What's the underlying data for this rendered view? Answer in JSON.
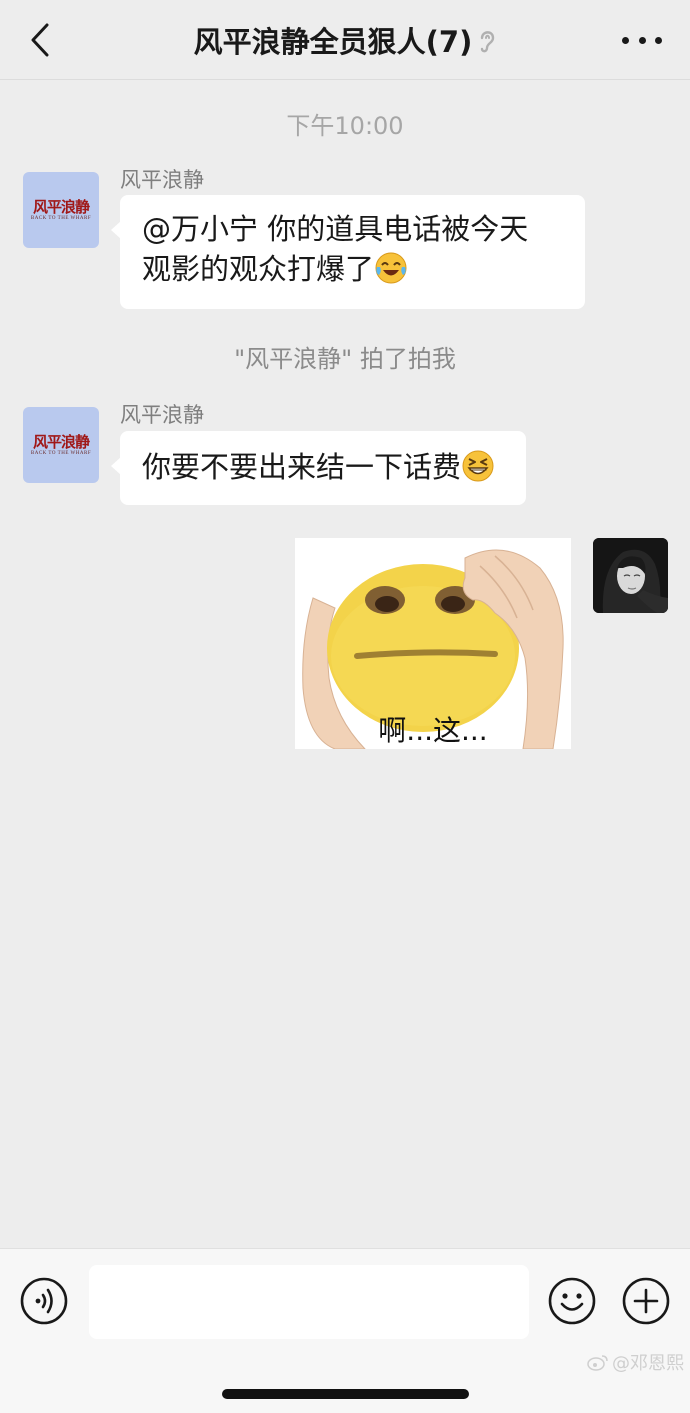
{
  "header": {
    "title": "风平浪静全员狠人(7)"
  },
  "chat": {
    "timestamp": "下午10:00",
    "messages": [
      {
        "sender": "风平浪静",
        "text": "@万小宁 你的道具电话被今天观影的观众打爆了",
        "line1": "@万小宁 你的道具电话被今天",
        "line2": "观影的观众打爆了",
        "emoji": "laughing-crying-emoji"
      },
      {
        "sender": "风平浪静",
        "text": "你要不要出来结一下话费",
        "emoji": "grinning-squint-emoji"
      }
    ],
    "system_notice": "\"风平浪静\" 拍了拍我",
    "sticker": {
      "caption": "啊...这..."
    },
    "group_avatar": {
      "logo_text": "风平浪静",
      "logo_sub": "BACK TO THE WHARF"
    }
  },
  "watermark": "@邓恩熙",
  "colors": {
    "background": "#ededed",
    "bubble": "#ffffff",
    "avatar_bg": "#b9c9ee",
    "logo_red": "#a01818"
  }
}
